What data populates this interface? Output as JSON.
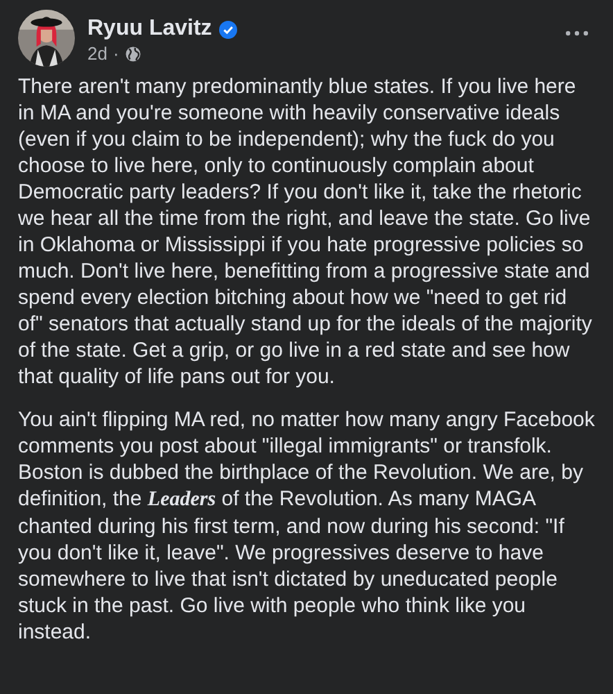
{
  "post": {
    "author": "Ryuu Lavitz",
    "verified": true,
    "time": "2d",
    "separator": "·",
    "paragraphs": [
      "There aren't many predominantly blue states. If you live here in MA and you're someone with heavily conservative ideals (even if you claim to be independent); why the fuck do you choose to live here, only to continuously complain about Democratic party leaders? If you don't like it, take the rhetoric we hear all the time from the right, and leave the state. Go live in Oklahoma or Mississippi if you hate progressive policies so much. Don't live here, benefitting from a progressive state and spend every election bitching about how we \"need to get rid of\" senators that actually stand up for the ideals of the majority of the state. Get a grip, or go live in a red state and see how that quality of life pans out for you.",
      "You ain't flipping MA red, no matter how many angry Facebook comments you post about \"illegal immigrants\" or transfolk. Boston is dubbed the birthplace of the Revolution. We are, by definition, the **Leaders** of the Revolution. As many MAGA chanted during his first term, and now during his second: \"If you don't like it, leave\". We progressives deserve to have somewhere to live that isn't dictated by uneducated people stuck in the past. Go live with people who think like you instead."
    ]
  }
}
